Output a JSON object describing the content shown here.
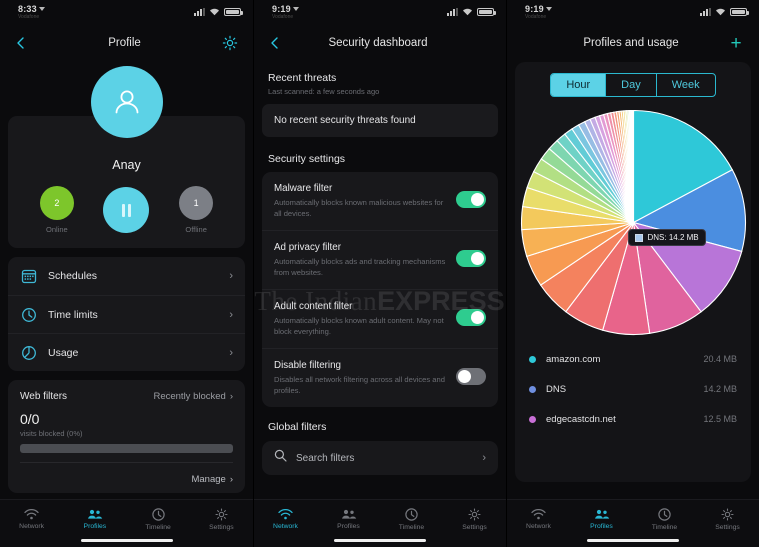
{
  "screens": {
    "profile": {
      "status": {
        "time": "8:33",
        "carrier": "Vodafone"
      },
      "nav": {
        "back": "back-chevron",
        "title": "Profile",
        "action": "settings-gear"
      },
      "avatar_name": "Anay",
      "states": {
        "online_count": "2",
        "online_label": "Online",
        "offline_count": "1",
        "offline_label": "Offline",
        "pause_label": "Pause"
      },
      "menu": [
        {
          "icon": "calendar-icon",
          "label": "Schedules"
        },
        {
          "icon": "clock-icon",
          "label": "Time limits"
        },
        {
          "icon": "pie-chart-icon",
          "label": "Usage"
        }
      ],
      "web_filters": {
        "title": "Web filters",
        "link": "Recently blocked",
        "count": "0/0",
        "sub": "visits blocked (0%)",
        "manage": "Manage"
      }
    },
    "security": {
      "status": {
        "time": "9:19",
        "carrier": "Vodafone"
      },
      "nav": {
        "back": "back-chevron",
        "title": "Security dashboard"
      },
      "recent_threats": {
        "heading": "Recent threats",
        "subtitle": "Last scanned: a few seconds ago",
        "banner": "No recent security threats found"
      },
      "settings_heading": "Security settings",
      "settings": [
        {
          "title": "Malware filter",
          "desc": "Automatically blocks known malicious websites for all devices.",
          "state": "on"
        },
        {
          "title": "Ad privacy filter",
          "desc": "Automatically blocks ads and tracking mechanisms from websites.",
          "state": "on"
        },
        {
          "title": "Adult content filter",
          "desc": "Automatically blocks known adult content. May not block everything.",
          "state": "on"
        },
        {
          "title": "Disable filtering",
          "desc": "Disables all network filtering across all devices and profiles.",
          "state": "off"
        }
      ],
      "global_filters": {
        "heading": "Global filters",
        "search_placeholder": "Search filters"
      }
    },
    "usage": {
      "status": {
        "time": "9:19",
        "carrier": "Vodafone"
      },
      "nav": {
        "title": "Profiles and usage",
        "action": "plus-icon"
      },
      "range_tabs": [
        {
          "label": "Hour",
          "active": true
        },
        {
          "label": "Day",
          "active": false
        },
        {
          "label": "Week",
          "active": false
        }
      ],
      "tooltip": {
        "label": "DNS",
        "value": "14.2 MB",
        "text": "DNS: 14.2 MB",
        "swatch": "#a9c8ec"
      },
      "legend": [
        {
          "name": "amazon.com",
          "value": "20.4 MB",
          "color": "#2ec8d8"
        },
        {
          "name": "DNS",
          "value": "14.2 MB",
          "color": "#6f8fe0"
        },
        {
          "name": "edgecastcdn.net",
          "value": "12.5 MB",
          "color": "#c86fd6"
        }
      ]
    }
  },
  "tabbar": {
    "items": [
      {
        "icon": "wifi-icon",
        "label": "Network"
      },
      {
        "icon": "profiles-icon",
        "label": "Profiles"
      },
      {
        "icon": "clock-icon",
        "label": "Timeline"
      },
      {
        "icon": "gear-icon",
        "label": "Settings"
      }
    ],
    "active_profile": 1,
    "active_security": 0,
    "active_usage": 1
  },
  "watermark": {
    "a": "The Indian",
    "b": "EXPRESS"
  },
  "colors": {
    "accent_cyan": "#5cd2e6",
    "toggle_on": "#2ecc8f",
    "toggle_off": "#6e7076",
    "online_green": "#7dc62b",
    "offline_gray": "#7c7f86",
    "tab_active": "#29b7d4"
  },
  "chart_data": {
    "type": "pie",
    "title": "Profiles and usage",
    "unit": "MB",
    "legend_position": "below",
    "labels": [
      "amazon.com",
      "DNS",
      "edgecastcdn.net",
      "slice-4",
      "slice-5",
      "slice-6",
      "slice-7",
      "slice-8",
      "slice-9",
      "slice-10",
      "slice-11",
      "slice-12",
      "slice-13",
      "slice-14",
      "slice-15",
      "slice-16",
      "slice-17",
      "slice-18",
      "slice-19",
      "slice-20",
      "slice-21",
      "slice-22",
      "slice-23",
      "slice-24",
      "slice-25",
      "slice-26",
      "slice-27",
      "slice-28",
      "slice-29",
      "slice-30",
      "slice-31",
      "slice-32",
      "slice-33",
      "slice-34",
      "slice-35",
      "slice-36",
      "slice-37",
      "slice-38"
    ],
    "values": [
      20.4,
      14.2,
      12.5,
      9.5,
      8.0,
      7.0,
      6.2,
      5.4,
      4.6,
      3.9,
      3.3,
      2.9,
      2.5,
      2.2,
      1.9,
      1.7,
      1.5,
      1.3,
      1.15,
      1.0,
      0.9,
      0.8,
      0.72,
      0.65,
      0.58,
      0.52,
      0.47,
      0.42,
      0.38,
      0.34,
      0.31,
      0.28,
      0.25,
      0.22,
      0.2,
      0.18,
      0.16,
      0.14
    ],
    "colors": [
      "#2ec8d8",
      "#4b8ee0",
      "#b875d8",
      "#e0639e",
      "#e8648a",
      "#ee6f6f",
      "#f4825e",
      "#f79a52",
      "#f7b154",
      "#f3c95c",
      "#e9dd6a",
      "#d2e276",
      "#b2df84",
      "#94da97",
      "#7ed6b0",
      "#6fd2c6",
      "#62ccd6",
      "#7bc6e0",
      "#97bde4",
      "#b0b4e6",
      "#c4aae4",
      "#d6a2e0",
      "#e39bd4",
      "#ea95c0",
      "#ee90a8",
      "#f08f92",
      "#f2977f",
      "#f3a474",
      "#f4b56f",
      "#f2c870",
      "#ecd877",
      "#dfe282",
      "#c8e291",
      "#ade0a3",
      "#93dcb8",
      "#7fd8c9",
      "#74d2d6",
      "#7fcbe0"
    ],
    "highlighted": "DNS",
    "highlight_value": "14.2 MB"
  }
}
